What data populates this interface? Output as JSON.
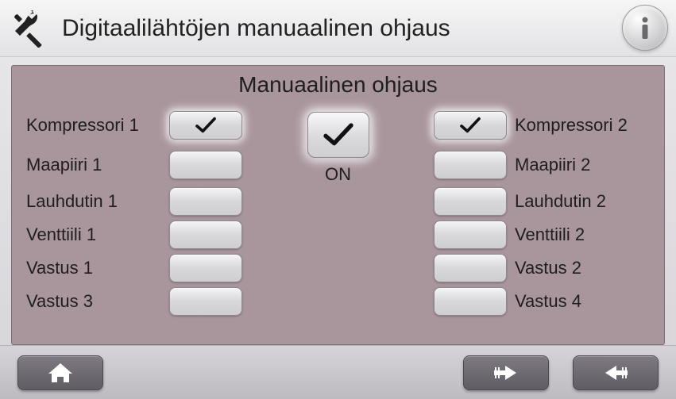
{
  "header": {
    "title": "Digitaalilähtöjen manuaalinen ohjaus"
  },
  "panel": {
    "title": "Manuaalinen ohjaus",
    "center_state": "ON",
    "center_checked": true,
    "rows": [
      {
        "left_label": "Kompressori 1",
        "left_checked": true,
        "right_label": "Kompressori 2",
        "right_checked": true
      },
      {
        "left_label": "Maapiiri 1",
        "left_checked": false,
        "right_label": "Maapiiri 2",
        "right_checked": false
      },
      {
        "left_label": "Lauhdutin 1",
        "left_checked": false,
        "right_label": "Lauhdutin 2",
        "right_checked": false
      },
      {
        "left_label": "Venttiili 1",
        "left_checked": false,
        "right_label": "Venttiili 2",
        "right_checked": false
      },
      {
        "left_label": "Vastus 1",
        "left_checked": false,
        "right_label": "Vastus 2",
        "right_checked": false
      },
      {
        "left_label": "Vastus 3",
        "left_checked": false,
        "right_label": "Vastus 4",
        "right_checked": false
      }
    ]
  },
  "icons": {
    "tools": "tools-icon",
    "info": "info-icon",
    "home": "home-icon",
    "next": "arrow-right-icon",
    "back": "arrow-left-icon",
    "check": "check-icon"
  }
}
